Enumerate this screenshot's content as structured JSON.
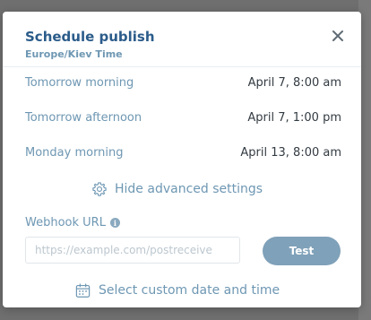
{
  "modal": {
    "title": "Schedule publish",
    "timezone": "Europe/Kiev Time",
    "close_icon": "close-icon"
  },
  "options": [
    {
      "label": "Tomorrow morning",
      "value": "April 7, 8:00 am"
    },
    {
      "label": "Tomorrow afternoon",
      "value": "April 7, 1:00 pm"
    },
    {
      "label": "Monday morning",
      "value": "April 13, 8:00 am"
    }
  ],
  "advanced": {
    "label": "Hide advanced settings",
    "icon": "gear-icon"
  },
  "webhook": {
    "label": "Webhook URL",
    "info_icon": "info-icon",
    "placeholder": "https://example.com/postreceive",
    "value": "",
    "test_label": "Test"
  },
  "custom": {
    "label": "Select custom date and time",
    "icon": "calendar-icon"
  },
  "colors": {
    "title": "#2b5c8a",
    "accent": "#6e97b3",
    "button": "#7fa1b9"
  }
}
